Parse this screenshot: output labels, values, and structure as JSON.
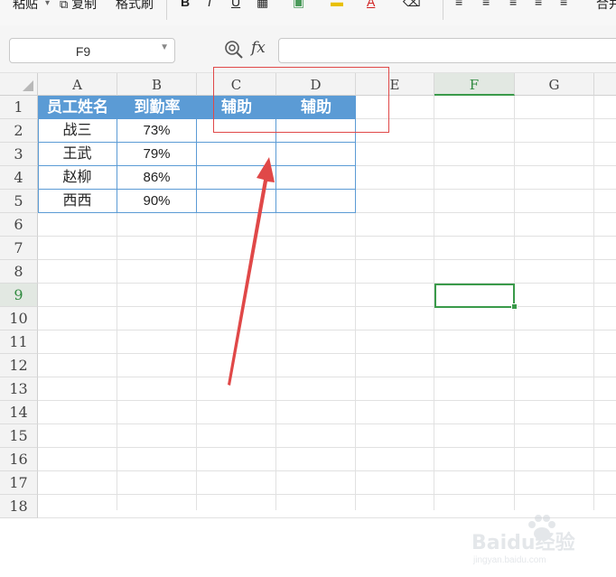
{
  "toolbar": {
    "paste_label": "粘贴",
    "copy_label": "复制",
    "format_painter_label": "格式刷",
    "bold_label": "B",
    "italic_label": "I",
    "underline_label": "U",
    "font_color_label": "A",
    "merge_label": "合并"
  },
  "formula_bar": {
    "name_box": "F9",
    "fx_label": "fx",
    "formula_value": ""
  },
  "columns": [
    "A",
    "B",
    "C",
    "D",
    "E",
    "F",
    "G"
  ],
  "selected_column": "F",
  "rows": [
    "1",
    "2",
    "3",
    "4",
    "5",
    "6",
    "7",
    "8",
    "9",
    "10",
    "11",
    "12",
    "13",
    "14",
    "15",
    "16",
    "17",
    "18"
  ],
  "selected_row": "9",
  "table": {
    "headers": [
      "员工姓名",
      "到勤率",
      "辅助",
      "辅助"
    ],
    "rows": [
      [
        "战三",
        "73%",
        "",
        ""
      ],
      [
        "王武",
        "79%",
        "",
        ""
      ],
      [
        "赵柳",
        "86%",
        "",
        ""
      ],
      [
        "西西",
        "90%",
        "",
        ""
      ]
    ]
  },
  "annotation_color": "#e04848",
  "header_fill_color": "#5b9bd5",
  "selection_color": "#3a9a4a",
  "watermark": {
    "brand": "Baidu经验",
    "url": "jingyan.baidu.com"
  }
}
